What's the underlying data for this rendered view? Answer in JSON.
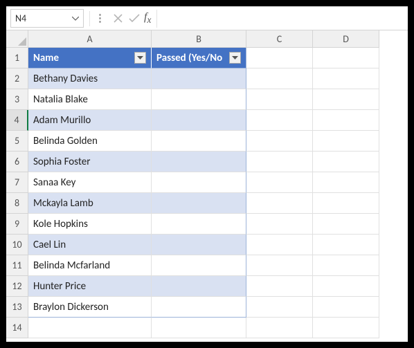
{
  "nameBox": "N4",
  "formulaValue": "",
  "columns": [
    "A",
    "B",
    "C",
    "D"
  ],
  "activeRow": 4,
  "table": {
    "headers": [
      "Name",
      "Passed (Yes/No"
    ],
    "rows": [
      {
        "name": "Bethany Davies",
        "passed": ""
      },
      {
        "name": "Natalia Blake",
        "passed": ""
      },
      {
        "name": "Adam Murillo",
        "passed": ""
      },
      {
        "name": "Belinda Golden",
        "passed": ""
      },
      {
        "name": "Sophia Foster",
        "passed": ""
      },
      {
        "name": "Sanaa Key",
        "passed": ""
      },
      {
        "name": "Mckayla Lamb",
        "passed": ""
      },
      {
        "name": "Kole Hopkins",
        "passed": ""
      },
      {
        "name": "Cael Lin",
        "passed": ""
      },
      {
        "name": "Belinda Mcfarland",
        "passed": ""
      },
      {
        "name": "Hunter Price",
        "passed": ""
      },
      {
        "name": "Braylon Dickerson",
        "passed": ""
      }
    ]
  },
  "rowNumbers": [
    1,
    2,
    3,
    4,
    5,
    6,
    7,
    8,
    9,
    10,
    11,
    12,
    13,
    14
  ]
}
